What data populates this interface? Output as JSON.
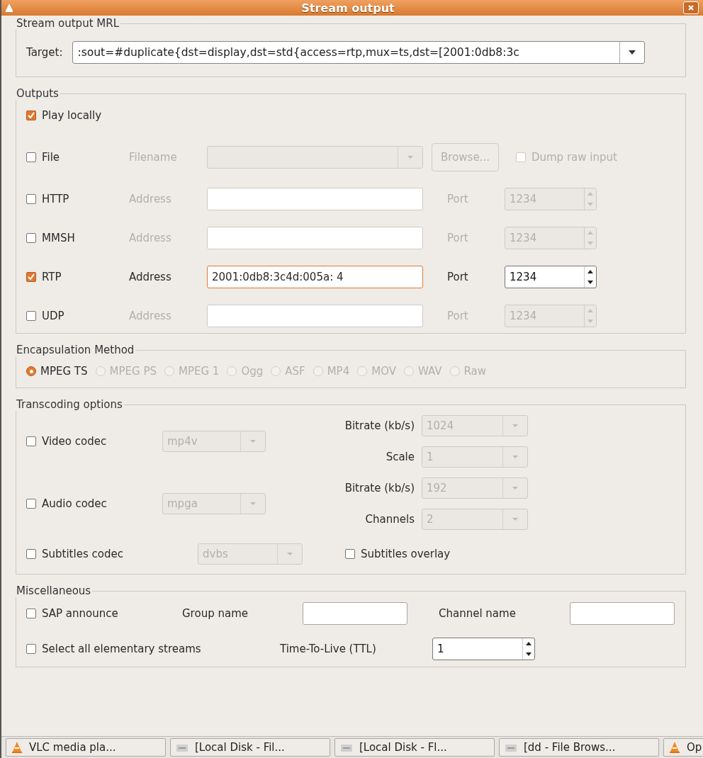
{
  "window": {
    "title": "Stream output"
  },
  "mrl": {
    "legend": "Stream output MRL",
    "target_label": "Target:",
    "target_value": ":sout=#duplicate{dst=display,dst=std{access=rtp,mux=ts,dst=[2001:0db8:3c"
  },
  "outputs": {
    "legend": "Outputs",
    "items": [
      {
        "kind": "local",
        "label": "Play locally",
        "checked": true
      },
      {
        "kind": "file",
        "label": "File",
        "checked": false,
        "disabled": true,
        "field_label": "Filename",
        "button": "Browse...",
        "extra": {
          "label": "Dump raw input",
          "checked": false
        }
      },
      {
        "kind": "network",
        "label": "HTTP",
        "checked": false,
        "disabled": true,
        "field_label": "Address",
        "port_label": "Port",
        "port": "1234"
      },
      {
        "kind": "network",
        "label": "MMSH",
        "checked": false,
        "disabled": true,
        "field_label": "Address",
        "port_label": "Port",
        "port": "1234"
      },
      {
        "kind": "network",
        "label": "RTP",
        "checked": true,
        "disabled": false,
        "field_label": "Address",
        "value": "2001:0db8:3c4d:005a: 4",
        "focused": true,
        "port_label": "Port",
        "port": "1234"
      },
      {
        "kind": "network",
        "label": "UDP",
        "checked": false,
        "disabled": true,
        "field_label": "Address",
        "port_label": "Port",
        "port": "1234"
      }
    ]
  },
  "encapsulation": {
    "legend": "Encapsulation Method",
    "options": [
      {
        "label": "MPEG TS",
        "selected": true,
        "disabled": false
      },
      {
        "label": "MPEG PS",
        "selected": false,
        "disabled": true
      },
      {
        "label": "MPEG 1",
        "selected": false,
        "disabled": true
      },
      {
        "label": "Ogg",
        "selected": false,
        "disabled": true
      },
      {
        "label": "ASF",
        "selected": false,
        "disabled": true
      },
      {
        "label": "MP4",
        "selected": false,
        "disabled": true
      },
      {
        "label": "MOV",
        "selected": false,
        "disabled": true
      },
      {
        "label": "WAV",
        "selected": false,
        "disabled": true
      },
      {
        "label": "Raw",
        "selected": false,
        "disabled": true
      }
    ]
  },
  "transcoding": {
    "legend": "Transcoding options",
    "codecs": [
      {
        "label": "Video codec",
        "checked": false,
        "codec": "mp4v",
        "params": [
          {
            "label": "Bitrate (kb/s)",
            "value": "1024"
          },
          {
            "label": "Scale",
            "value": "1"
          }
        ]
      },
      {
        "label": "Audio codec",
        "checked": false,
        "codec": "mpga",
        "params": [
          {
            "label": "Bitrate (kb/s)",
            "value": "192"
          },
          {
            "label": "Channels",
            "value": "2"
          }
        ]
      }
    ],
    "subtitles": {
      "label": "Subtitles codec",
      "checked": false,
      "codec": "dvbs",
      "overlay": {
        "label": "Subtitles overlay",
        "checked": false
      }
    }
  },
  "misc": {
    "legend": "Miscellaneous",
    "sap": {
      "label": "SAP announce",
      "checked": false
    },
    "group_label": "Group name",
    "channel_label": "Channel name",
    "select_all": {
      "label": "Select all elementary streams",
      "checked": false
    },
    "ttl_label": "Time-To-Live (TTL)",
    "ttl": "1"
  },
  "taskbar": [
    {
      "kind": "vlc",
      "label": "VLC media pla..."
    },
    {
      "kind": "folder",
      "label": "[Local Disk - Fil..."
    },
    {
      "kind": "folder",
      "label": "[Local Disk - Fl..."
    },
    {
      "kind": "folder",
      "label": "[dd - File Brows..."
    },
    {
      "kind": "vlc",
      "label": "Op"
    }
  ]
}
